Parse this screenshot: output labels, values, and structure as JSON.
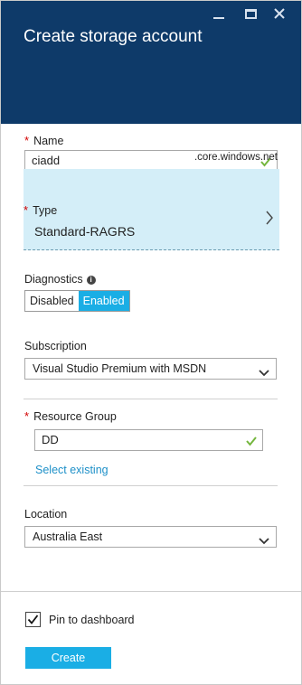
{
  "header": {
    "title": "Create storage account"
  },
  "name_field": {
    "label": "Name",
    "required_mark": "*",
    "value": "ciadd",
    "suffix": ".core.windows.net"
  },
  "type_field": {
    "label": "Type",
    "required_mark": "*",
    "value": "Standard-RAGRS"
  },
  "diagnostics": {
    "label": "Diagnostics",
    "info_glyph": "i",
    "options": [
      "Disabled",
      "Enabled"
    ],
    "selected": "Enabled"
  },
  "subscription": {
    "label": "Subscription",
    "value": "Visual Studio Premium with MSDN"
  },
  "resource_group": {
    "label": "Resource Group",
    "required_mark": "*",
    "value": "DD",
    "link": "Select existing"
  },
  "location": {
    "label": "Location",
    "value": "Australia East"
  },
  "footer": {
    "pin_label": "Pin to dashboard",
    "pin_checked": true,
    "create_label": "Create"
  },
  "colors": {
    "header_bg": "#0e3a69",
    "accent": "#1aaee5",
    "selected_row_bg": "#d4eef8",
    "required": "#d40000",
    "valid_check": "#74b63d",
    "link": "#1e90c8"
  },
  "icons": [
    "minimize-icon",
    "maximize-icon",
    "close-icon",
    "checkmark-icon",
    "chevron-right-icon",
    "info-icon",
    "chevron-down-icon",
    "checkbox-check-icon"
  ]
}
